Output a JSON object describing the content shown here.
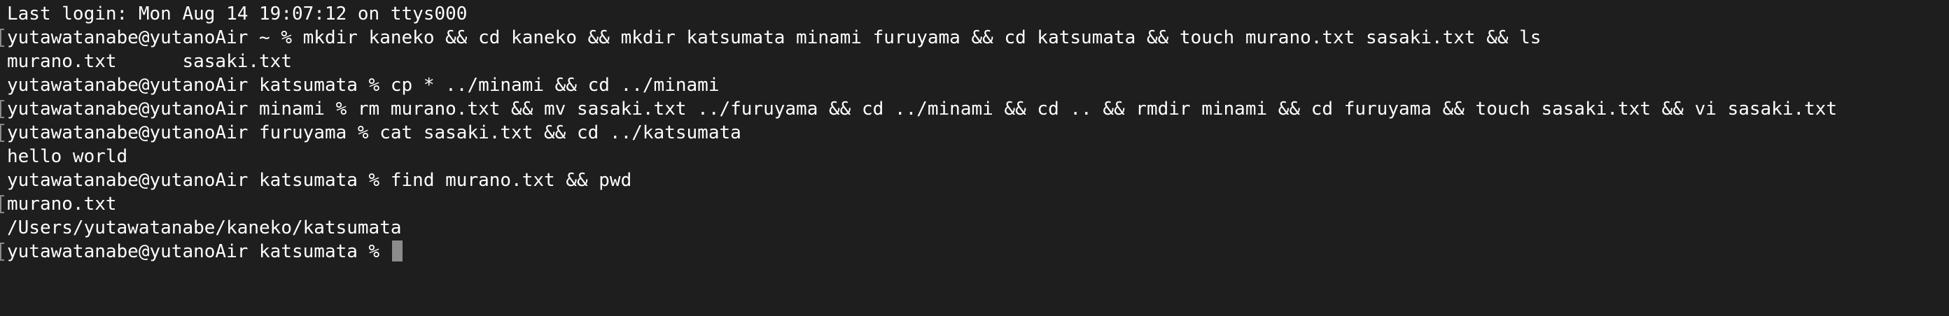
{
  "terminal": {
    "lines": [
      "Last login: Mon Aug 14 19:07:12 on ttys000",
      "yutawatanabe@yutanoAir ~ % mkdir kaneko && cd kaneko && mkdir katsumata minami furuyama && cd katsumata && touch murano.txt sasaki.txt && ls",
      "murano.txt      sasaki.txt",
      "yutawatanabe@yutanoAir katsumata % cp * ../minami && cd ../minami",
      "yutawatanabe@yutanoAir minami % rm murano.txt && mv sasaki.txt ../furuyama && cd ../minami && cd .. && rmdir minami && cd furuyama && touch sasaki.txt && vi sasaki.txt",
      "yutawatanabe@yutanoAir furuyama % cat sasaki.txt && cd ../katsumata",
      "hello world",
      "yutawatanabe@yutanoAir katsumata % find murano.txt && pwd",
      "murano.txt",
      "/Users/yutawatanabe/kaneko/katsumata",
      "yutawatanabe@yutanoAir katsumata % "
    ]
  },
  "colors": {
    "background": "#1e1e1e",
    "text": "#ffffff",
    "cursor": "#8c8c8c"
  }
}
